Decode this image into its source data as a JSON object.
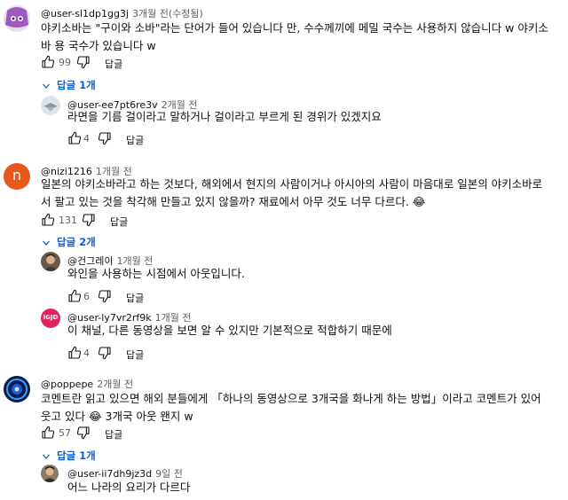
{
  "comments": [
    {
      "handle": "@user-sl1dp1gg3j",
      "time": "3개월 전(수정됨)",
      "text": "야키소바는 \"구이와 소바\"라는 단어가 들어 있습니다 만, 수수께끼에 메밀 국수는 사용하지 않습니다 w 야키소바 용 국수가 있습니다 w",
      "likes": "99",
      "reply_label": "답글",
      "replies_label": "답글 1개"
    },
    {
      "handle": "@user-ee7pt6re3v",
      "time": "2개월 전",
      "text": "라면을 기름 걸이라고 말하거나 걸이라고 부르게 된 경위가 있겠지요",
      "likes": "4",
      "reply_label": "답글"
    },
    {
      "avatar_letter": "n",
      "handle": "@nizi1216",
      "time": "1개월 전",
      "text": "일본의 야키소바라고 하는 것보다, 해외에서 현지의 사람이거나 아시아의 사람이 마음대로 일본의 야키소바로서 팔고 있는 것을 착각해 만들고 있지 않을까? 재료에서 아무 것도 너무 다르다. 😂",
      "likes": "131",
      "reply_label": "답글",
      "replies_label": "답글 2개"
    },
    {
      "handle": "@건그레이",
      "time": "1개월 전",
      "text": "와인을 사용하는 시점에서 아웃입니다.",
      "likes": "6",
      "reply_label": "답글"
    },
    {
      "avatar_text": "IGJD",
      "handle": "@user-ly7vr2rf9k",
      "time": "1개월 전",
      "text": "이 채널, 다른 동영상을 보면 알 수 있지만 기본적으로 적합하기 때문에",
      "likes": "4",
      "reply_label": "답글"
    },
    {
      "handle": "@poppepe",
      "time": "2개월 전",
      "text": "코멘트란 읽고 있으면 해외 분들에게 「하나의 동영상으로 3개국을 화나게 하는 방법」이라고 코멘트가 있어 웃고 있다 😂 3개국 아웃 왠지 w",
      "likes": "57",
      "reply_label": "답글",
      "replies_label": "답글 1개"
    },
    {
      "handle": "@user-ii7dh9jz3d",
      "time": "9일 전",
      "text": "어느 나라의 요리가 다르다"
    }
  ],
  "colors": {
    "link": "#065fd4",
    "muted": "#606060",
    "text": "#0f0f0f",
    "nizi_avatar": "#e8571c"
  }
}
